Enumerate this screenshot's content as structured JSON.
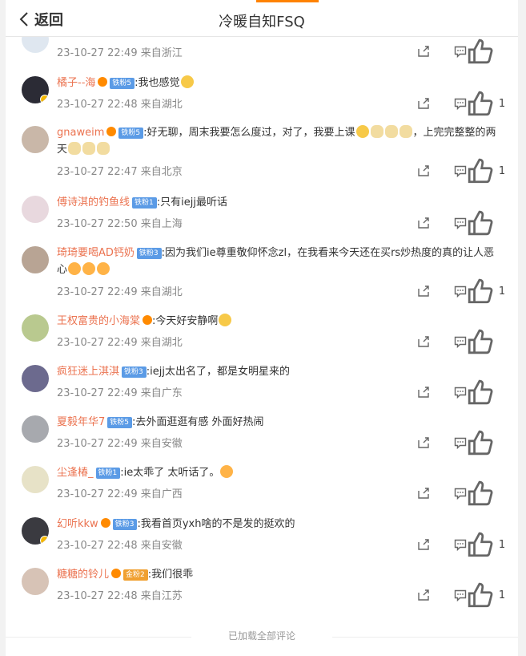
{
  "header": {
    "back_label": "返回",
    "title": "冷暖自知FSQ"
  },
  "comments": [
    {
      "name": "",
      "badge": "",
      "text": "",
      "meta": "23-10-27 22:49 来自浙江",
      "likes": ""
    },
    {
      "name": "橘子--海",
      "badge": "铁粉5",
      "text": ":我也感觉",
      "meta": "23-10-27 22:48 来自湖北",
      "likes": "1"
    },
    {
      "name": "gnaweim",
      "badge": "铁粉5",
      "text": ":好无聊，周末我要怎么度过，对了，我要上课",
      "text2": "，上完完整整的两",
      "text3": "天",
      "meta": "23-10-27 22:47 来自北京",
      "likes": "1"
    },
    {
      "name": "傅诗淇的钓鱼线",
      "badge": "铁粉1",
      "text": ":只有iejj最听话",
      "meta": "23-10-27 22:50 来自上海",
      "likes": ""
    },
    {
      "name": "琦琦要喝AD钙奶",
      "badge": "铁粉3",
      "text": ":因为我们ie尊重敬仰怀念zl，在我看来今天还在买rs炒热度的真的让人恶",
      "text2": "心",
      "meta": "23-10-27 22:49 来自湖北",
      "likes": "1"
    },
    {
      "name": "王权富贵的小海棠",
      "badge": "",
      "text": ":今天好安静啊",
      "meta": "23-10-27 22:49 来自湖北",
      "likes": ""
    },
    {
      "name": "疯狂迷上淇淇",
      "badge": "铁粉3",
      "text": ":iejj太出名了，都是女明星来的",
      "meta": "23-10-27 22:49 来自广东",
      "likes": ""
    },
    {
      "name": "夏毅年华7",
      "badge": "铁粉5",
      "text": ":去外面逛逛有感   外面好热闹",
      "meta": "23-10-27 22:49 来自安徽",
      "likes": ""
    },
    {
      "name": "尘逢椿_",
      "badge": "铁粉1",
      "text": ":ie太乖了 太听话了。",
      "meta": "23-10-27 22:49 来自广西",
      "likes": ""
    },
    {
      "name": "幻听kkw",
      "badge": "铁粉3",
      "text": ":我看首页yxh啥的不是发的挺欢的",
      "meta": "23-10-27 22:48 来自安徽",
      "likes": "1"
    },
    {
      "name": "糖糖的铃儿",
      "badge": "金粉2",
      "text": ":我们很乖",
      "meta": "23-10-27 22:48 来自江苏",
      "likes": "1"
    }
  ],
  "footer": {
    "text": "已加载全部评论"
  },
  "colors": {
    "accent": "#ff8200",
    "username": "#eb7350",
    "meta": "#888888",
    "fan_badge": "#5b9be6"
  }
}
